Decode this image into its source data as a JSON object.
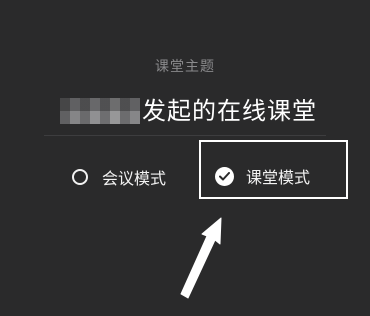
{
  "section_label": "课堂主题",
  "title": {
    "redacted_name": "",
    "text": "发起的在线课堂"
  },
  "options": [
    {
      "label": "会议模式",
      "selected": false
    },
    {
      "label": "课堂模式",
      "selected": true
    }
  ],
  "icons": {
    "radio_unselected": "radio-empty-icon",
    "radio_selected": "check-circle-icon",
    "annotation": "arrow-up-icon"
  },
  "colors": {
    "background": "#2a2a2b",
    "text_primary": "#ffffff",
    "text_secondary": "#8a8a8c",
    "divider": "#3d3d3f",
    "highlight": "#ffffff"
  }
}
